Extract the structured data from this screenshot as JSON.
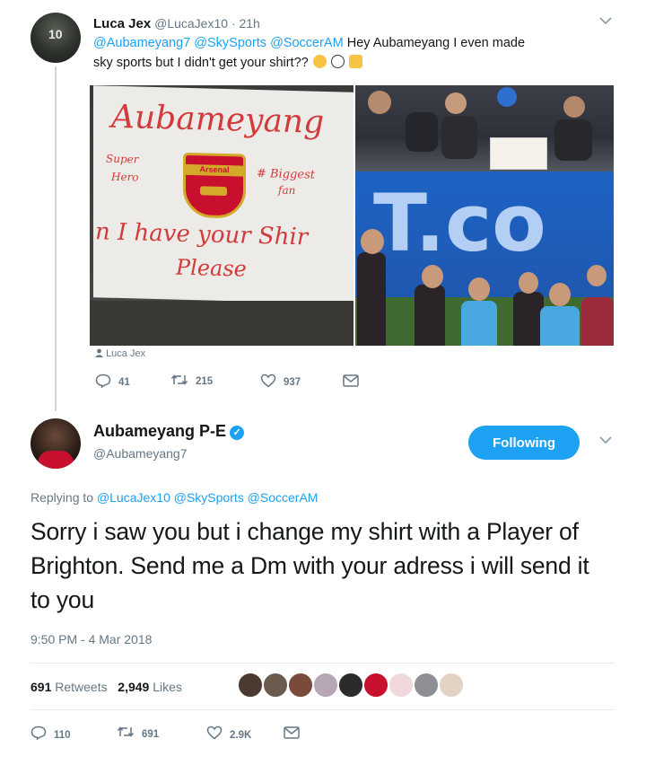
{
  "tweet1": {
    "author_name": "Luca Jex",
    "author_handle": "@LucaJex10",
    "time": "· 21h",
    "avatar_number": "10",
    "text": "@Aubameyang7 @SkySports @SoccerAM Hey Aubameyang I even made sky sports but I didn't get your shirt??",
    "mentions": "@Aubameyang7 @SkySports @SoccerAM",
    "body_line1_rest": " Hey Aubameyang I even made",
    "body_line2": "sky sports but I didn't get your shirt??",
    "sign": {
      "line1": "Aubameyang",
      "left_note_1": "Super",
      "left_note_2": "Hero",
      "crest_text": "Arsenal",
      "right_note_1": "# Biggest",
      "right_note_2": "fan",
      "line3": "n I have your Shir",
      "line4": "Please"
    },
    "board_letters": "T.co",
    "photo_credit": "Luca Jex",
    "replies": "41",
    "retweets": "215",
    "likes": "937"
  },
  "tweet2": {
    "author_name": "Aubameyang P-E",
    "author_handle": "@Aubameyang7",
    "verified_glyph": "✓",
    "follow_label": "Following",
    "replying_prefix": "Replying to",
    "replying_handles": "@LucaJex10 @SkySports @SoccerAM",
    "text": "Sorry i saw you but i change my shirt with a Player of Brighton. Send me a Dm with your adress i will send it to you",
    "timestamp": "9:50 PM - 4 Mar 2018",
    "retweets_count": "691",
    "retweets_label": "Retweets",
    "likes_count": "2,949",
    "likes_label": "Likes",
    "replies": "110",
    "retweets": "691",
    "likes": "2.9K"
  },
  "icons": {
    "reply": "reply-icon",
    "retweet": "retweet-icon",
    "like": "heart-icon",
    "dm": "envelope-icon",
    "chevron": "chevron-down-icon",
    "verified": "verified-badge-icon",
    "person": "person-icon"
  },
  "colors": {
    "accent": "#1da1f2",
    "text": "#14171a",
    "muted": "#657786",
    "arsenal_red": "#c8102e"
  }
}
